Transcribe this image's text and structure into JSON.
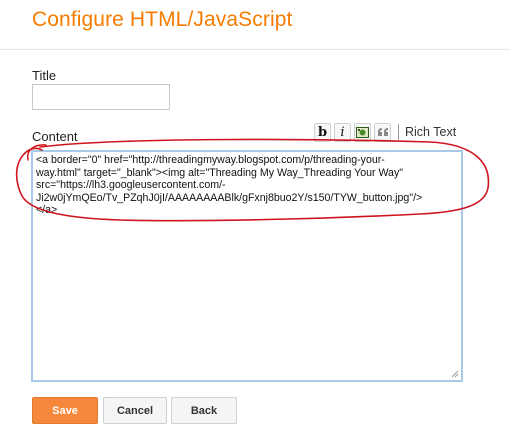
{
  "page": {
    "title": "Configure HTML/JavaScript"
  },
  "form": {
    "title_label": "Title",
    "title_value": "",
    "content_label": "Content",
    "content_value": "<a border=\"0\" href=\"http://threadingmyway.blogspot.com/p/threading-your-\nway.html\" target=\"_blank\"><img alt=\"Threading My Way_Threading Your Way\"\nsrc=\"https://lh3.googleusercontent.com/-\nJi2w0jYmQEo/Tv_PZqhJ0jI/AAAAAAAABlk/gFxnj8buo2Y/s150/TYW_button.jpg\"/>\n</a>"
  },
  "toolbar": {
    "bold": "b",
    "italic": "i",
    "image_icon": "image-icon",
    "quote": "66",
    "rich_text": "Rich Text"
  },
  "buttons": {
    "save": "Save",
    "cancel": "Cancel",
    "back": "Back"
  },
  "colors": {
    "accent": "#f57c00",
    "save": "#f5883a",
    "annotation": "#d0141e",
    "textarea_border": "#a9c9e8"
  }
}
